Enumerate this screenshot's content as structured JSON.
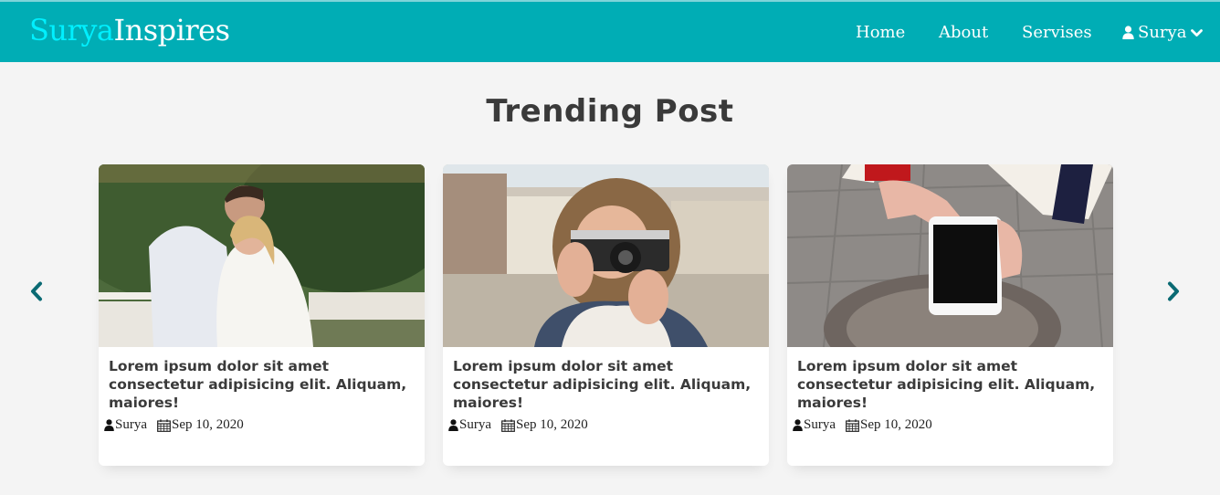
{
  "brand": {
    "part1": "Surya",
    "part2": "Inspires"
  },
  "nav": {
    "home": "Home",
    "about": "About",
    "services": "Servises",
    "user": "Surya"
  },
  "section": {
    "title": "Trending Post"
  },
  "posts": [
    {
      "image": "couple-photo",
      "title": "Lorem ipsum dolor sit amet consectetur adipisicing elit. Aliquam, maiores!",
      "author": "Surya",
      "date": "Sep 10, 2020"
    },
    {
      "image": "woman-camera-photo",
      "title": "Lorem ipsum dolor sit amet consectetur adipisicing elit. Aliquam, maiores!",
      "author": "Surya",
      "date": "Sep 10, 2020"
    },
    {
      "image": "hands-phone-photo",
      "title": "Lorem ipsum dolor sit amet consectetur adipisicing elit. Aliquam, maiores!",
      "author": "Surya",
      "date": "Sep 10, 2020"
    }
  ],
  "icons": {
    "user": "user-icon",
    "calendar": "calendar-icon",
    "prev": "chevron-left-icon",
    "next": "chevron-right-icon",
    "dropdown": "chevron-down-icon"
  },
  "colors": {
    "navbar": "#00adb5",
    "brand_accent": "#00f0ff",
    "arrow": "#0a6a73",
    "heading": "#3a3a3a",
    "page_bg": "#f4f4f4"
  }
}
